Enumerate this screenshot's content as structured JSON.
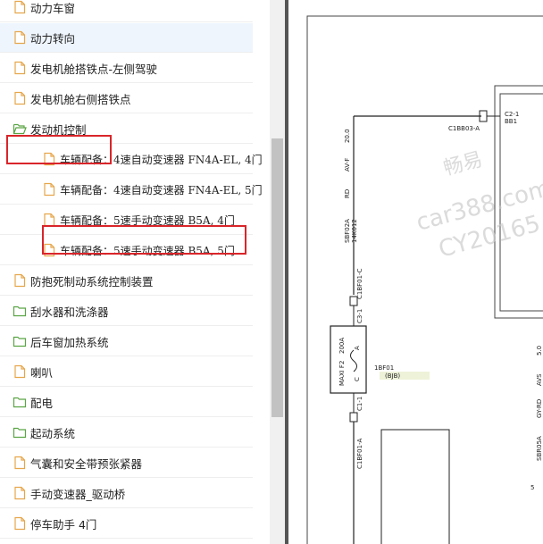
{
  "tree": {
    "items": [
      {
        "label": "动力车窗",
        "icon": "file-icon"
      },
      {
        "label": "动力转向",
        "icon": "file-icon",
        "selected": true
      },
      {
        "label": "发电机舱搭铁点-左侧驾驶",
        "icon": "file-icon"
      },
      {
        "label": "发电机舱右侧搭铁点",
        "icon": "file-icon"
      },
      {
        "label": "发动机控制",
        "icon": "folder-open-icon",
        "highlighted": true
      },
      {
        "label": "车辆配备：4速自动变速器 FN4A-EL, 4门",
        "icon": "file-icon",
        "indent": 1
      },
      {
        "label": "车辆配备：4速自动变速器 FN4A-EL, 5门",
        "icon": "file-icon",
        "indent": 1
      },
      {
        "label": "车辆配备：5速手动变速器 B5A, 4门",
        "icon": "file-icon",
        "indent": 1,
        "highlighted": true
      },
      {
        "label": "车辆配备：5速手动变速器 B5A, 5门",
        "icon": "file-icon",
        "indent": 1
      },
      {
        "label": "防抱死制动系统控制装置",
        "icon": "file-icon"
      },
      {
        "label": "刮水器和洗涤器",
        "icon": "folder-icon"
      },
      {
        "label": "后车窗加热系统",
        "icon": "folder-icon"
      },
      {
        "label": "喇叭",
        "icon": "file-icon"
      },
      {
        "label": "配电",
        "icon": "folder-icon"
      },
      {
        "label": "起动系统",
        "icon": "folder-icon"
      },
      {
        "label": "气囊和安全带预张紧器",
        "icon": "file-icon"
      },
      {
        "label": "手动变速器_驱动桥",
        "icon": "file-icon"
      },
      {
        "label": "停车助手 4门",
        "icon": "file-icon"
      }
    ]
  },
  "diagram": {
    "connector_top": "C2-1",
    "connector_top_sub": "BB1",
    "connector_ref": "C1BB03-A",
    "wire_gauge": "20.0",
    "wire_type": "AV-F",
    "wire_color": "RD",
    "wire_id": "SBF02A",
    "wire_id2": "14K012",
    "splice_top": "C1BF01-C",
    "pin_top": "C3-1",
    "fuse_label": "MAXI F2",
    "fuse_rating": "200A",
    "fuse_pin_a": "A",
    "fuse_pin_c": "C",
    "fuse_ref": "1BF01",
    "fuse_box": "(BJB)",
    "pin_bottom": "C1-1",
    "splice_bottom": "C1BF01-A",
    "right_gauge": "5.0",
    "right_type": "AVS",
    "right_color": "GY-RD",
    "right_id": "SBR05A",
    "right_pin": "5",
    "watermark_1": "畅易",
    "watermark_2": "car388.com",
    "watermark_3": "CY20165"
  },
  "colors": {
    "highlight": "#d9252a",
    "file_icon": "#e6a64a",
    "folder_icon": "#5aa544",
    "selected_row": "#eef5fd"
  }
}
